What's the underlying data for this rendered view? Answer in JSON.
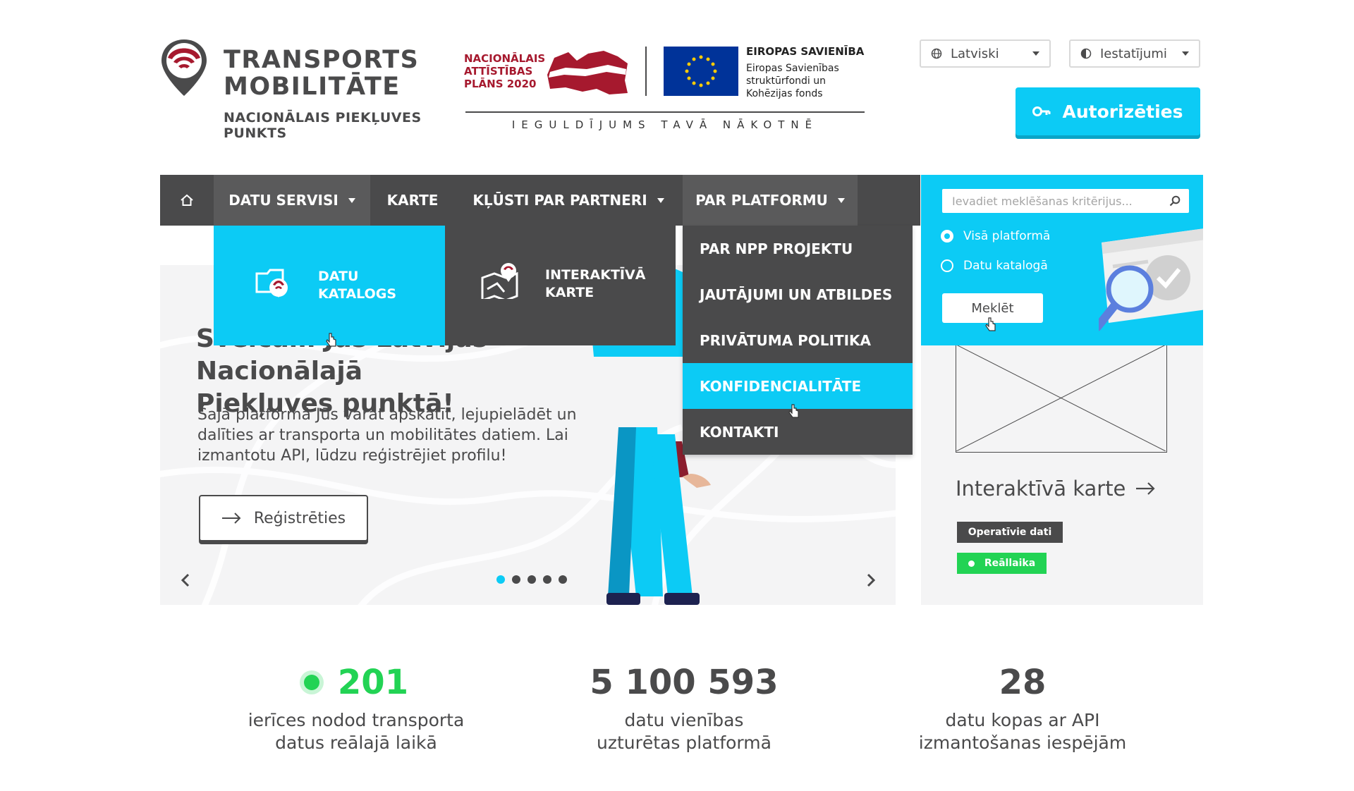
{
  "logo": {
    "title_line1": "TRANSPORTS",
    "title_line2": "MOBILITĀTE",
    "subtitle_line1": "NACIONĀLAIS PIEKĻUVES",
    "subtitle_line2": "PUNKTS"
  },
  "nap": {
    "line1": "NACIONĀLAIS",
    "line2": "ATTĪSTĪBAS",
    "line3": "PLĀNS 2020"
  },
  "eu": {
    "title": "EIROPAS SAVIENĪBA",
    "line1": "Eiropas Savienības",
    "line2": "struktūrfondi un",
    "line3": "Kohēzijas fonds"
  },
  "slogan": "IEGULDĪJUMS TAVĀ NĀKOTNĒ",
  "header": {
    "language": "Latviski",
    "settings": "Iestatījumi",
    "login": "Autorizēties"
  },
  "nav": {
    "datu_servisi": "DATU SERVISI",
    "karte": "KARTE",
    "klusti": "KĻŪSTI PAR PARTNERI",
    "par_platformu": "PAR PLATFORMU"
  },
  "dropdown_datu": {
    "catalog_line1": "DATU",
    "catalog_line2": "KATALOGS",
    "map_line1": "INTERAKTĪVĀ",
    "map_line2": "KARTE"
  },
  "dropdown_platforma": {
    "items": [
      "PAR NPP PROJEKTU",
      "JAUTĀJUMI UN ATBILDES",
      "PRIVĀTUMA POLITIKA",
      "KONFIDENCIALITĀTE",
      "KONTAKTI"
    ]
  },
  "search": {
    "placeholder": "Ievadiet meklēšanas kritērijus...",
    "option1": "Visā platformā",
    "option2": "Datu katalogā",
    "button": "Meklēt"
  },
  "hero": {
    "title_line1": "Sveicam Jūs Latvijas Nacionālajā",
    "title_line2": "Piekļuves punktā!",
    "text": "Šajā platformā Jūs varat apskatīt, lejupielādēt un dalīties ar transporta un mobilitātes datiem. Lai izmantotu API, lūdzu reģistrējiet profilu!",
    "register": "Reģistrēties"
  },
  "card": {
    "title": "Interaktīvā karte",
    "tag1": "Operatīvie dati",
    "tag2": "Reāllaika"
  },
  "stats": [
    {
      "value": "201",
      "line1": "ierīces nodod transporta",
      "line2": "datus reālajā laikā"
    },
    {
      "value": "5 100 593",
      "line1": "datu vienības",
      "line2": "uzturētas platformā"
    },
    {
      "value": "28",
      "line1": "datu kopas ar API",
      "line2": "izmantošanas iespējām"
    }
  ],
  "colors": {
    "accent": "#0ccbf5",
    "dark": "#4a4a4b",
    "brand_red": "#a6192e",
    "green": "#22d354"
  }
}
